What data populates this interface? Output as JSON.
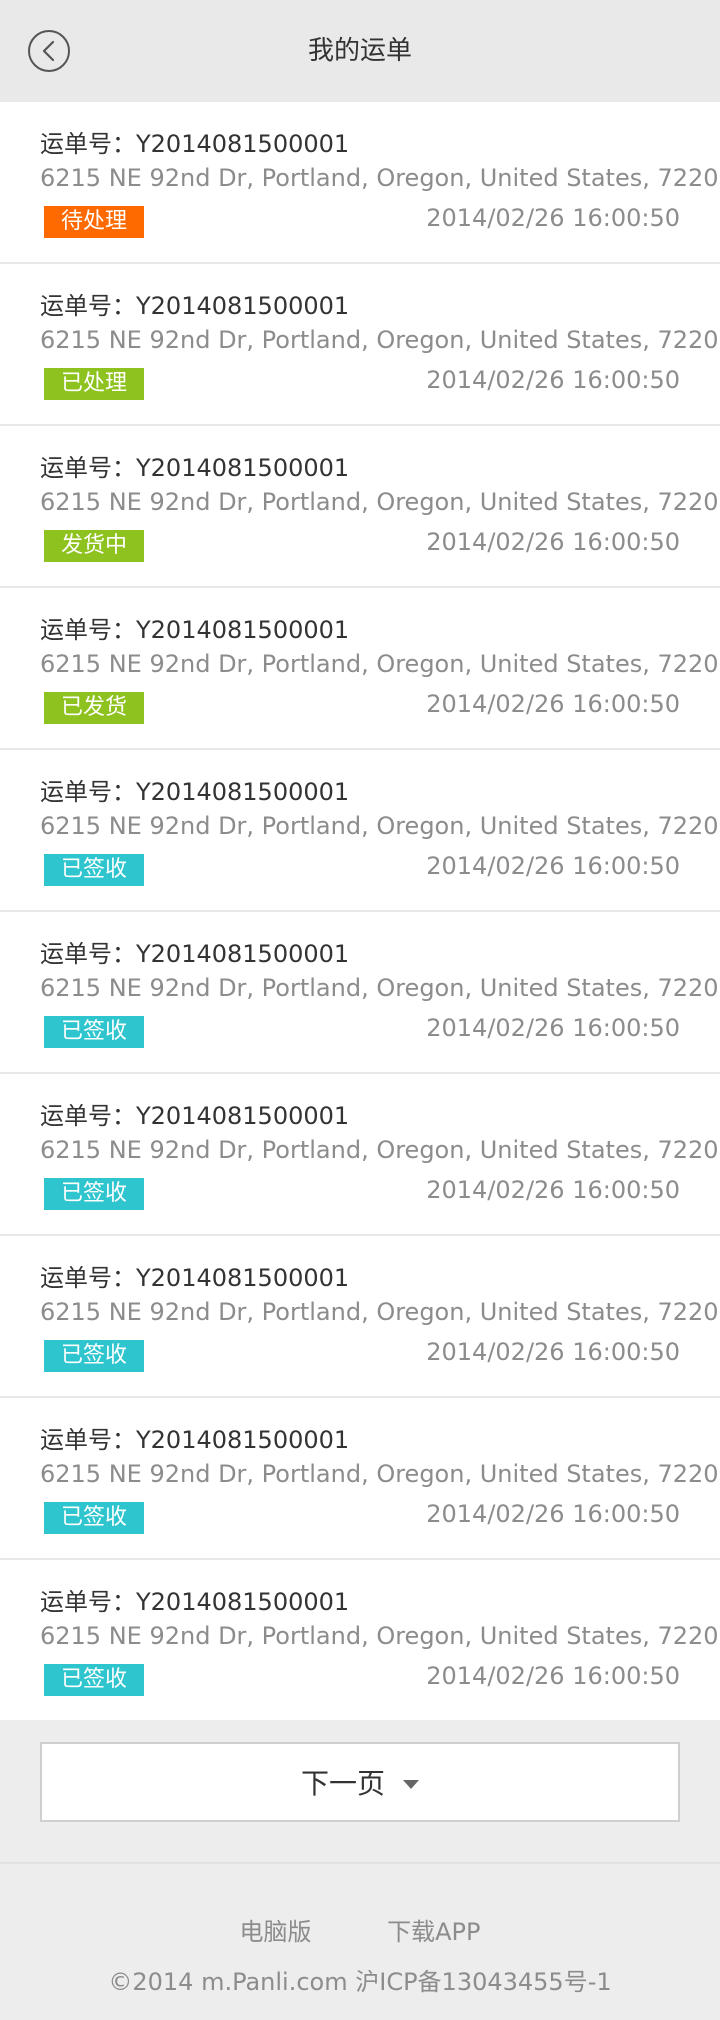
{
  "header": {
    "title": "我的运单",
    "back_icon": "chevron-left-circle-icon"
  },
  "colors": {
    "pending": "#ff6a00",
    "processed": "#8dc21f",
    "shipping": "#8dc21f",
    "shipped": "#8dc21f",
    "signed": "#2ec5cf"
  },
  "orders": [
    {
      "label": "运单号：Y2014081500001",
      "address": "6215 NE 92nd Dr, Portland, Oregon, United States, 7220",
      "status": "待处理",
      "status_color": "#ff6a00",
      "time": "2014/02/26 16:00:50"
    },
    {
      "label": "运单号：Y2014081500001",
      "address": "6215 NE 92nd Dr, Portland, Oregon, United States, 7220",
      "status": "已处理",
      "status_color": "#8dc21f",
      "time": "2014/02/26 16:00:50"
    },
    {
      "label": "运单号：Y2014081500001",
      "address": "6215 NE 92nd Dr, Portland, Oregon, United States, 7220",
      "status": "发货中",
      "status_color": "#8dc21f",
      "time": "2014/02/26 16:00:50"
    },
    {
      "label": "运单号：Y2014081500001",
      "address": "6215 NE 92nd Dr, Portland, Oregon, United States, 7220",
      "status": "已发货",
      "status_color": "#8dc21f",
      "time": "2014/02/26 16:00:50"
    },
    {
      "label": "运单号：Y2014081500001",
      "address": "6215 NE 92nd Dr, Portland, Oregon, United States, 7220",
      "status": "已签收",
      "status_color": "#2ec5cf",
      "time": "2014/02/26 16:00:50"
    },
    {
      "label": "运单号：Y2014081500001",
      "address": "6215 NE 92nd Dr, Portland, Oregon, United States, 7220",
      "status": "已签收",
      "status_color": "#2ec5cf",
      "time": "2014/02/26 16:00:50"
    },
    {
      "label": "运单号：Y2014081500001",
      "address": "6215 NE 92nd Dr, Portland, Oregon, United States, 7220",
      "status": "已签收",
      "status_color": "#2ec5cf",
      "time": "2014/02/26 16:00:50"
    },
    {
      "label": "运单号：Y2014081500001",
      "address": "6215 NE 92nd Dr, Portland, Oregon, United States, 7220",
      "status": "已签收",
      "status_color": "#2ec5cf",
      "time": "2014/02/26 16:00:50"
    },
    {
      "label": "运单号：Y2014081500001",
      "address": "6215 NE 92nd Dr, Portland, Oregon, United States, 7220",
      "status": "已签收",
      "status_color": "#2ec5cf",
      "time": "2014/02/26 16:00:50"
    },
    {
      "label": "运单号：Y2014081500001",
      "address": "6215 NE 92nd Dr, Portland, Oregon, United States, 7220",
      "status": "已签收",
      "status_color": "#2ec5cf",
      "time": "2014/02/26 16:00:50"
    }
  ],
  "pager": {
    "next_label": "下一页",
    "next_icon": "caret-down-icon"
  },
  "footer": {
    "desktop_link": "电脑版",
    "download_link": "下载APP",
    "copyright": "©2014 m.Panli.com  沪ICP备13043455号-1"
  }
}
